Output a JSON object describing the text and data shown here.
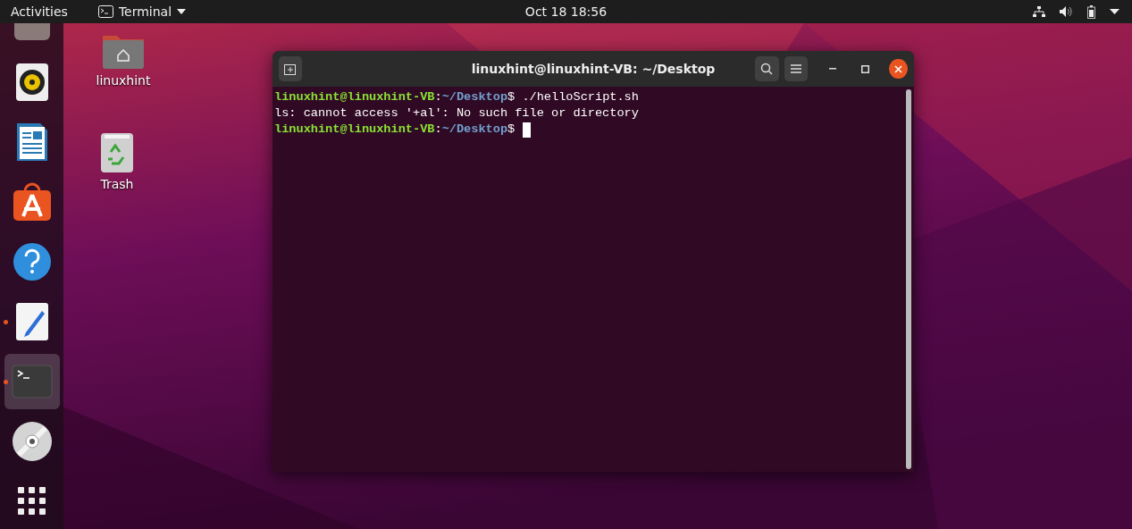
{
  "top_bar": {
    "activities": "Activities",
    "app_menu": "Terminal",
    "clock": "Oct 18  18:56"
  },
  "dock": [
    {
      "kind": "partial",
      "running": false,
      "selected": false
    },
    {
      "kind": "speaker",
      "running": false,
      "selected": false
    },
    {
      "kind": "writer",
      "running": false,
      "selected": false
    },
    {
      "kind": "store",
      "running": false,
      "selected": false
    },
    {
      "kind": "help",
      "running": false,
      "selected": false
    },
    {
      "kind": "editor",
      "running": true,
      "selected": false
    },
    {
      "kind": "terminal",
      "running": true,
      "selected": true
    },
    {
      "kind": "disc",
      "running": false,
      "selected": false
    },
    {
      "kind": "apps",
      "running": false,
      "selected": false
    }
  ],
  "desktop_icons": [
    {
      "kind": "home",
      "label": "linuxhint"
    },
    {
      "kind": "trash",
      "label": "Trash"
    }
  ],
  "terminal": {
    "title": "linuxhint@linuxhint-VB: ~/Desktop",
    "lines": [
      {
        "kind": "prompt",
        "user": "linuxhint@linuxhint-VB",
        "sep": ":",
        "path": "~/Desktop",
        "dollar": "$",
        "command": "./helloScript.sh",
        "cursor": false
      },
      {
        "kind": "output",
        "text": "ls: cannot access '+al': No such file or directory"
      },
      {
        "kind": "prompt",
        "user": "linuxhint@linuxhint-VB",
        "sep": ":",
        "path": "~/Desktop",
        "dollar": "$",
        "cursor": true
      }
    ]
  }
}
